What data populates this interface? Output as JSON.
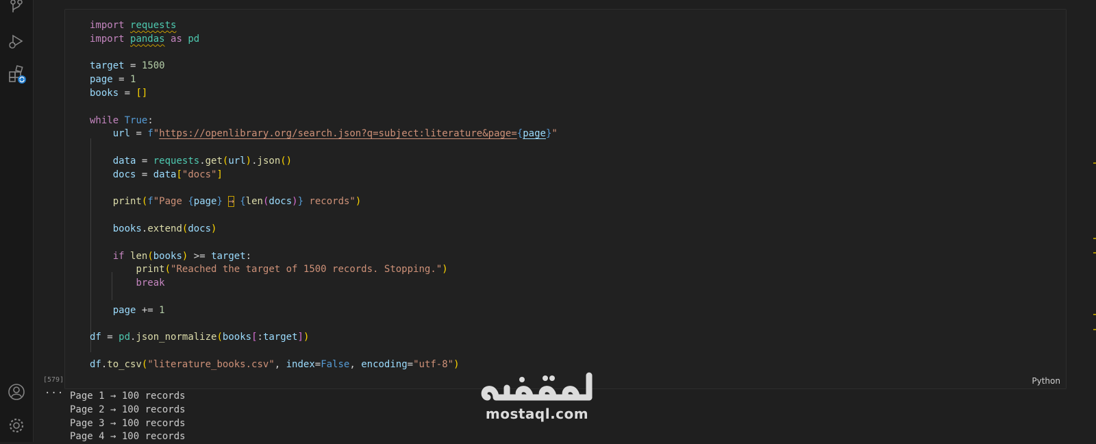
{
  "notebook": {
    "execution_count": "[579]",
    "language": "Python",
    "output_ellipsis": "···",
    "output_lines": [
      "Page 1 → 100 records",
      "Page 2 → 100 records",
      "Page 3 → 100 records",
      "Page 4 → 100 records"
    ]
  },
  "watermark": {
    "text": "mostaql.com",
    "logo_text": "مستقل"
  },
  "activity_bar": {
    "icons": [
      "source-control-icon",
      "run-debug-icon",
      "extensions-icon",
      "account-icon",
      "settings-gear-icon"
    ]
  }
}
